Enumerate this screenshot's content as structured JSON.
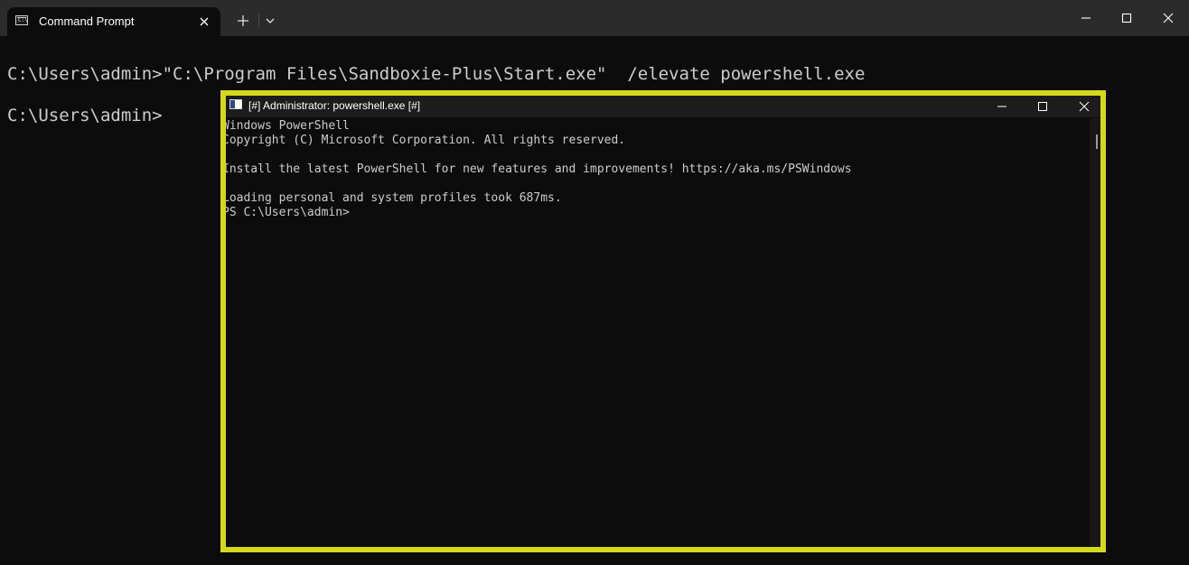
{
  "terminal": {
    "tab_title": "Command Prompt",
    "tab_icon": "cmd-icon",
    "new_tab_label": "+",
    "console_lines": [
      "C:\\Users\\admin>\"C:\\Program Files\\Sandboxie-Plus\\Start.exe\"  /elevate powershell.exe",
      "C:\\Users\\admin>"
    ]
  },
  "powershell_window": {
    "title": "[#] Administrator: powershell.exe [#]",
    "highlight_color": "#d6d81c",
    "console_lines": [
      "Windows PowerShell",
      "Copyright (C) Microsoft Corporation. All rights reserved.",
      "",
      "Install the latest PowerShell for new features and improvements! https://aka.ms/PSWindows",
      "",
      "Loading personal and system profiles took 687ms.",
      "PS C:\\Users\\admin>"
    ]
  },
  "colors": {
    "background": "#0c0c0c",
    "tabbar": "#2b2b2b",
    "text": "#cccccc",
    "highlight": "#d6d81c"
  }
}
